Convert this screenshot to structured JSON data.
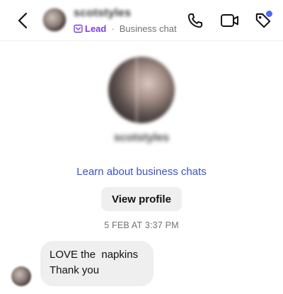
{
  "header": {
    "contact_name": "scotstyles",
    "lead_label": "Lead",
    "separator": "·",
    "chat_type": "Business chat"
  },
  "profile": {
    "display_name": "scotstyles",
    "learn_link": "Learn about business chats",
    "view_profile_label": "View profile"
  },
  "thread": {
    "timestamp": "5 FEB AT 3:37 PM",
    "messages": [
      {
        "lines": [
          "LOVE the  napkins",
          "Thank you"
        ]
      }
    ]
  },
  "colors": {
    "accent_link": "#3a52c6",
    "lead_purple": "#7b3fe4",
    "notification_dot": "#4a6cf7",
    "bubble_bg": "#efefef"
  },
  "icons": [
    "back-arrow-icon",
    "phone-icon",
    "video-camera-icon",
    "tag-icon",
    "lead-tag-icon"
  ]
}
